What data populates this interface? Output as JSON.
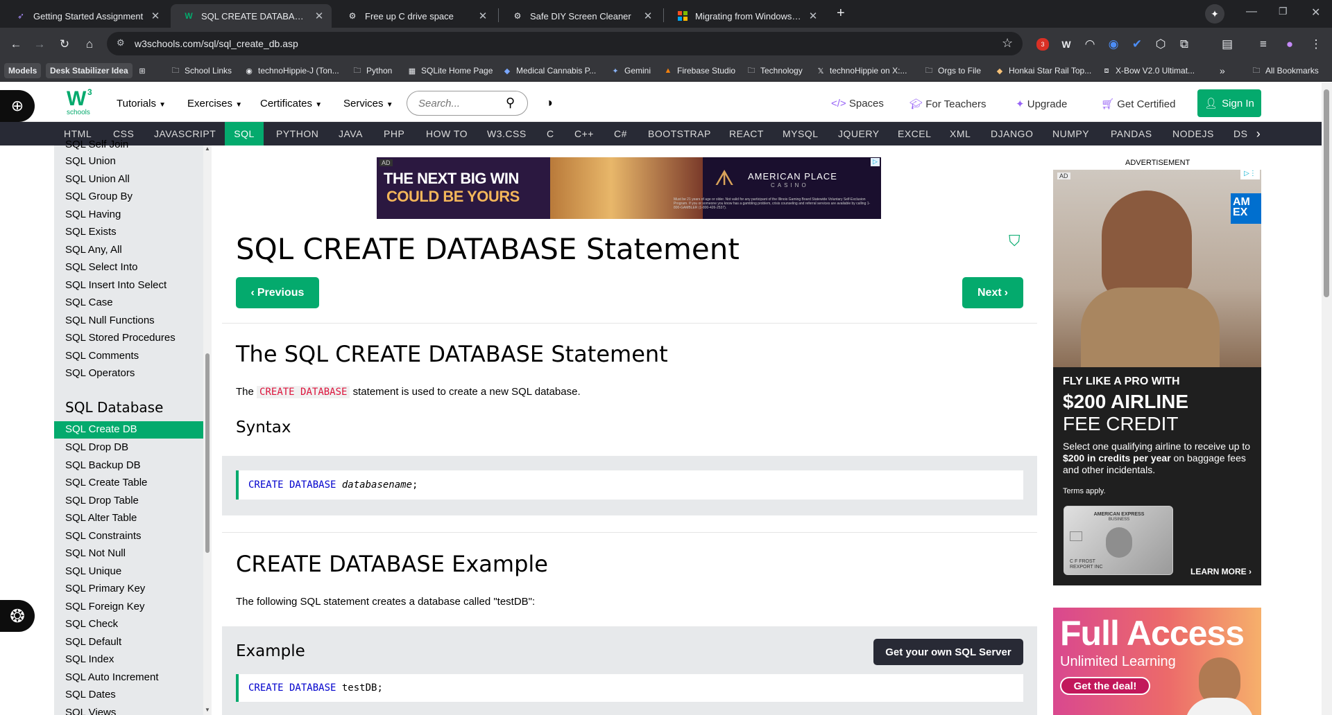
{
  "browser": {
    "tabs": [
      {
        "title": "Getting Started Assignment",
        "icon": "feather-icon"
      },
      {
        "title": "SQL CREATE DATABASE Statement",
        "icon": "w3schools-icon"
      },
      {
        "title": "Free up C drive space",
        "icon": "chat-icon"
      },
      {
        "title": "Safe DIY Screen Cleaner",
        "icon": "chat-icon"
      },
      {
        "title": "Migrating from Windows Power",
        "icon": "microsoft-icon"
      }
    ],
    "url": "w3schools.com/sql/sql_create_db.asp",
    "bookmarks": [
      "Models",
      "Desk Stabilizer Idea",
      "School Links",
      "technoHippie-J (Ton...",
      "Python",
      "SQLite Home Page",
      "Medical Cannabis P...",
      "Gemini",
      "Firebase Studio",
      "Technology",
      "technoHippie on X:...",
      "Orgs to File",
      "Honkai Star Rail Top...",
      "X-Bow V2.0 Ultimat...",
      "All Bookmarks"
    ],
    "extension_badge": "3"
  },
  "site": {
    "logo_main": "W",
    "logo_sup": "3",
    "logo_sub": "schools",
    "menu": [
      "Tutorials",
      "Exercises",
      "Certificates",
      "Services"
    ],
    "search_placeholder": "Search...",
    "right_links": [
      "Spaces",
      "For Teachers",
      "Upgrade",
      "Get Certified"
    ],
    "sign_in": "Sign In",
    "topnav": [
      "HTML",
      "CSS",
      "JAVASCRIPT",
      "SQL",
      "PYTHON",
      "JAVA",
      "PHP",
      "HOW TO",
      "W3.CSS",
      "C",
      "C++",
      "C#",
      "BOOTSTRAP",
      "REACT",
      "MYSQL",
      "JQUERY",
      "EXCEL",
      "XML",
      "DJANGO",
      "NUMPY",
      "PANDAS",
      "NODEJS",
      "DS"
    ]
  },
  "sidebar": {
    "partial_top": "SQL Self Join",
    "items_before": [
      "SQL Union",
      "SQL Union All",
      "SQL Group By",
      "SQL Having",
      "SQL Exists",
      "SQL Any, All",
      "SQL Select Into",
      "SQL Insert Into Select",
      "SQL Case",
      "SQL Null Functions",
      "SQL Stored Procedures",
      "SQL Comments",
      "SQL Operators"
    ],
    "section_title": "SQL Database",
    "active_item": "SQL Create DB",
    "items_after": [
      "SQL Drop DB",
      "SQL Backup DB",
      "SQL Create Table",
      "SQL Drop Table",
      "SQL Alter Table",
      "SQL Constraints",
      "SQL Not Null",
      "SQL Unique",
      "SQL Primary Key",
      "SQL Foreign Key",
      "SQL Check",
      "SQL Default",
      "SQL Index",
      "SQL Auto Increment",
      "SQL Dates",
      "SQL Views"
    ]
  },
  "banner_ad": {
    "tag": "AD",
    "headline_1": "THE NEXT BIG WIN",
    "headline_2": "COULD BE YOURS",
    "brand": "AMERICAN PLACE",
    "brand_sub": "CASINO",
    "fine_print": "Must be 21 years of age or older. Not valid for any participant of the Illinois Gaming Board Statewide Voluntary Self-Exclusion Program. If you or someone you know has a gambling problem, crisis counseling and referral services are available by calling 1-800-GAMBLER (1-800-426-2537)."
  },
  "main": {
    "page_title": "SQL CREATE DATABASE Statement",
    "prev_label": "Previous",
    "next_label": "Next",
    "section1_title": "The SQL CREATE DATABASE Statement",
    "section1_text_before": "The",
    "section1_code_inline": "CREATE DATABASE",
    "section1_text_after": "statement is used to create a new SQL database.",
    "syntax_title": "Syntax",
    "syntax_kw": "CREATE DATABASE",
    "syntax_arg": "databasename",
    "syntax_end": ";",
    "example_title": "CREATE DATABASE Example",
    "example_text": "The following SQL statement creates a database called \"testDB\":",
    "example_box_title": "Example",
    "example_button": "Get your own SQL Server",
    "example_kw": "CREATE DATABASE",
    "example_arg": "testDB;"
  },
  "side_ad": {
    "label": "ADVERTISEMENT",
    "tag": "AD",
    "brand": "AM EX",
    "headline_1": "FLY LIKE A PRO WITH",
    "headline_2": "$200 AIRLINE",
    "headline_3": "FEE CREDIT",
    "body_1": "Select one qualifying airline to receive up to",
    "body_bold": "$200 in credits per year",
    "body_2": "on baggage fees and other incidentals.",
    "terms": "Terms apply.",
    "card_brand": "AMERICAN EXPRESS",
    "card_sub": "BUSINESS",
    "card_name_1": "C F FROST",
    "card_name_2": "REXPORT INC",
    "learn_more": "LEARN MORE ›"
  },
  "promo_ad": {
    "title": "Full Access",
    "subtitle": "Unlimited Learning",
    "button": "Get the deal!"
  }
}
